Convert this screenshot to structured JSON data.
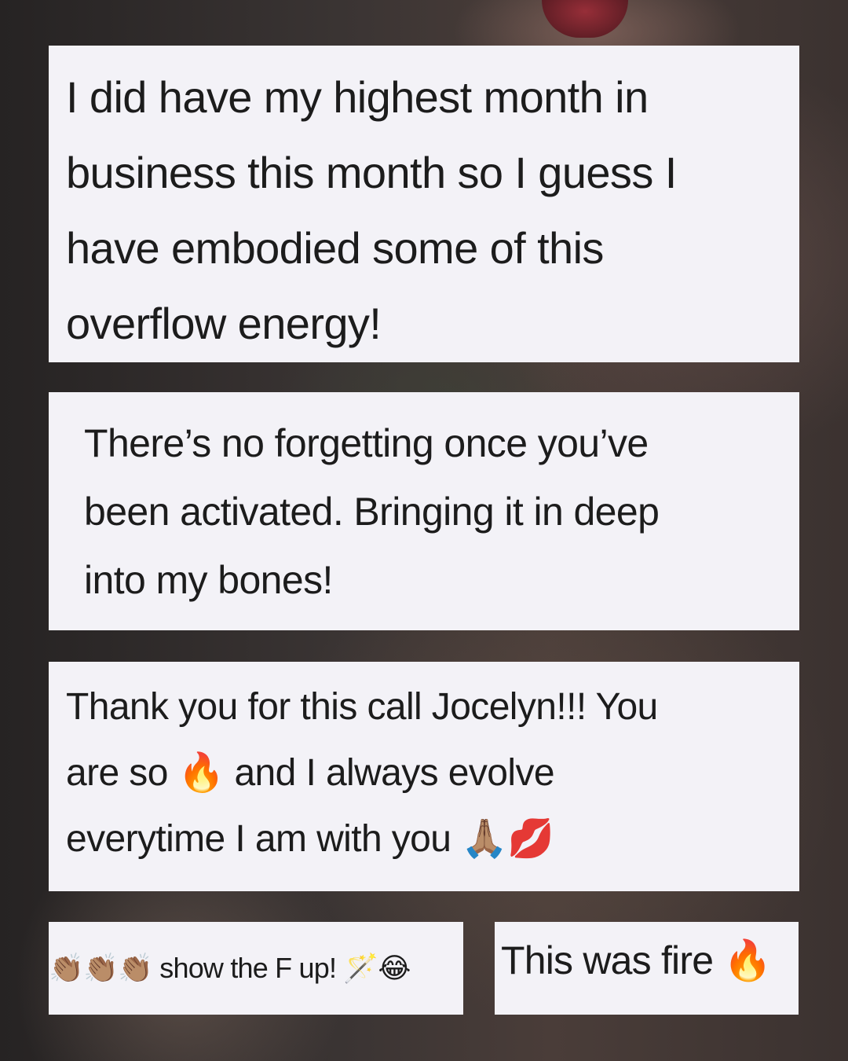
{
  "comments": [
    {
      "text": "I did have my highest month in\nbusiness this month so I guess I\nhave embodied some of this\noverflow energy!"
    },
    {
      "text": "There’s no forgetting once you’ve\nbeen activated. Bringing it in deep\ninto my bones!"
    },
    {
      "text": "Thank you for this call Jocelyn!!! You\nare so 🔥 and I always evolve\neverytime I am with you 🙏🏽💋"
    },
    {
      "text": "👏🏽👏🏽👏🏽 show the F up! 🪄😂"
    },
    {
      "text": "This was fire 🔥"
    }
  ]
}
